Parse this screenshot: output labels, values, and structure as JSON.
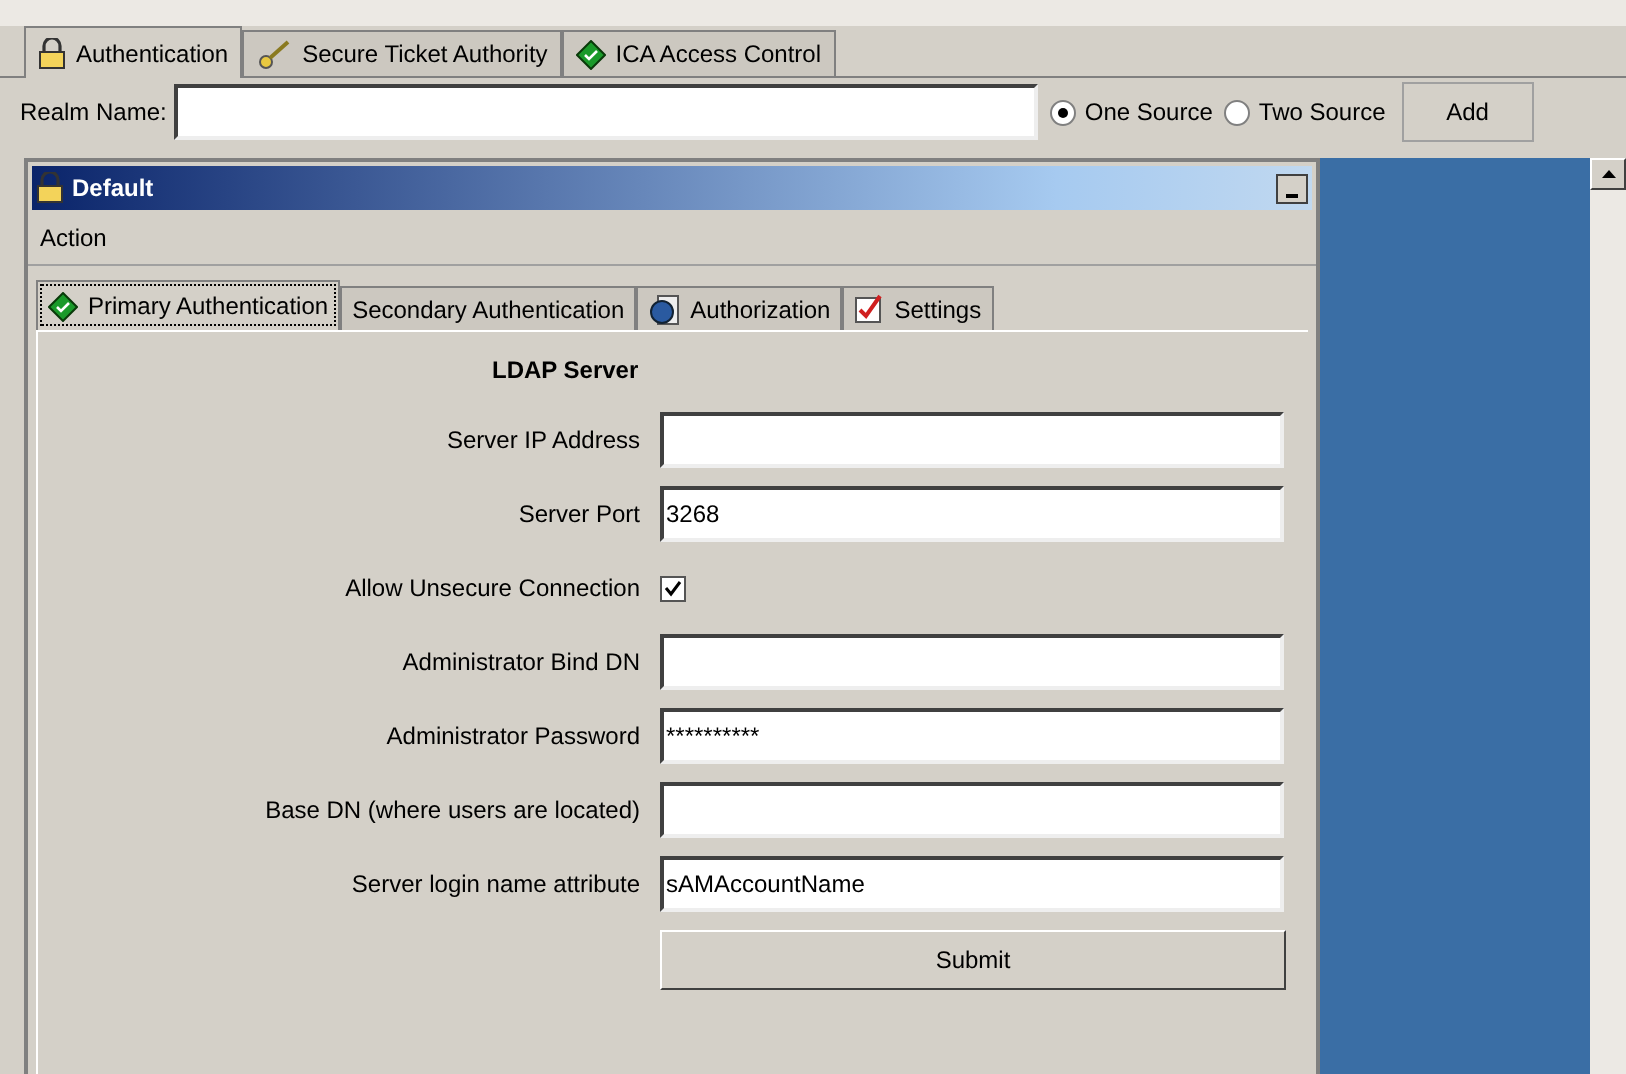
{
  "top_tabs": [
    {
      "label": "Authentication",
      "selected": true
    },
    {
      "label": "Secure Ticket Authority",
      "selected": false
    },
    {
      "label": "ICA Access Control",
      "selected": false
    }
  ],
  "realm": {
    "label": "Realm Name:",
    "sources": [
      {
        "label": "One Source",
        "selected": true
      },
      {
        "label": "Two Source",
        "selected": false
      }
    ],
    "add_button": "Add"
  },
  "panel": {
    "title": "Default",
    "menu": "Action",
    "tabs": [
      {
        "label": "Primary Authentication",
        "selected": true
      },
      {
        "label": "Secondary Authentication",
        "selected": false
      },
      {
        "label": "Authorization",
        "selected": false
      },
      {
        "label": "Settings",
        "selected": false
      }
    ],
    "heading": "LDAP Server",
    "fields": [
      {
        "kind": "text",
        "label": "Server IP Address"
      },
      {
        "kind": "text",
        "label": "Server Port",
        "value": "3268"
      },
      {
        "kind": "checkbox",
        "label": "Allow Unsecure Connection",
        "checked": true
      },
      {
        "kind": "text",
        "label": "Administrator Bind DN"
      },
      {
        "kind": "text",
        "label": "Administrator Password",
        "value": "**********"
      },
      {
        "kind": "text",
        "label": "Base DN (where users are located)"
      },
      {
        "kind": "text",
        "label": "Server login name attribute",
        "value": "sAMAccountName"
      }
    ],
    "submit": "Submit"
  }
}
